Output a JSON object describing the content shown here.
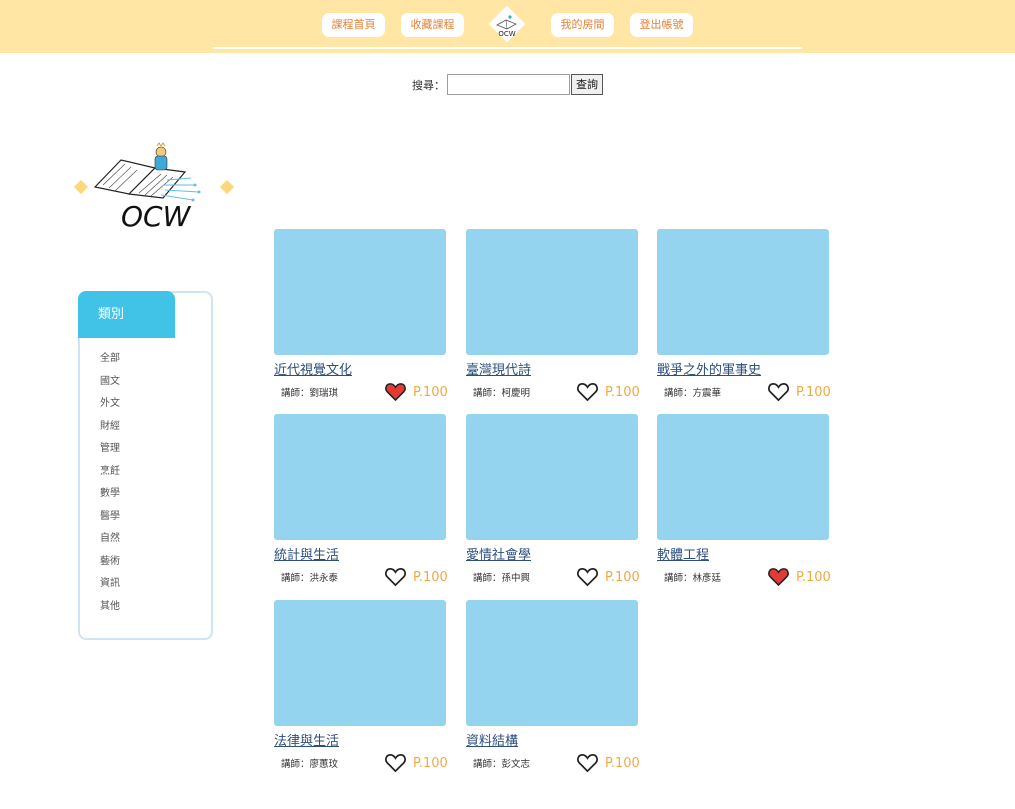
{
  "header": {
    "nav": [
      {
        "label": "課程首頁"
      },
      {
        "label": "收藏課程"
      },
      {
        "label": "我的房間"
      },
      {
        "label": "登出帳號"
      }
    ],
    "logo_text": "OCW"
  },
  "search": {
    "label": "搜尋：",
    "value": "",
    "button": "查詢"
  },
  "brand": {
    "logo_text": "OCW"
  },
  "sidebar": {
    "title": "類別",
    "categories": [
      "全部",
      "國文",
      "外文",
      "財經",
      "管理",
      "烹飪",
      "數學",
      "醫學",
      "自然",
      "藝術",
      "資訊",
      "其他"
    ]
  },
  "courses": [
    {
      "title": "近代視覺文化",
      "teacher": "講師：劉瑞琪",
      "liked": true,
      "price": "P.100"
    },
    {
      "title": "臺灣現代詩",
      "teacher": "講師：柯慶明",
      "liked": false,
      "price": "P.100"
    },
    {
      "title": "戰爭之外的軍事史",
      "teacher": "講師：方震華",
      "liked": false,
      "price": "P.100"
    },
    {
      "title": "統計與生活",
      "teacher": "講師：洪永泰",
      "liked": false,
      "price": "P.100"
    },
    {
      "title": "愛情社會學",
      "teacher": "講師：孫中興",
      "liked": false,
      "price": "P.100"
    },
    {
      "title": "軟體工程",
      "teacher": "講師：林彥廷",
      "liked": true,
      "price": "P.100"
    },
    {
      "title": "法律與生活",
      "teacher": "講師：廖蕙玟",
      "liked": false,
      "price": "P.100"
    },
    {
      "title": "資料結構",
      "teacher": "講師：彭文志",
      "liked": false,
      "price": "P.100"
    }
  ],
  "colors": {
    "header_bg": "#ffe6a4",
    "nav_text": "#e0833a",
    "category_tab": "#41c3e7",
    "thumbnail": "#94d4ef",
    "price": "#f2a941",
    "heart_liked": "#e53935"
  },
  "icons": {
    "heart_liked": "heart-filled-icon",
    "heart_unliked": "heart-outline-icon"
  }
}
